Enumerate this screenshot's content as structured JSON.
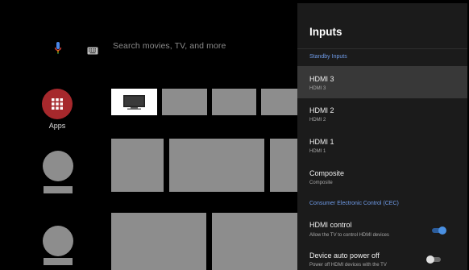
{
  "search": {
    "placeholder": "Search movies, TV, and more"
  },
  "apps": {
    "label": "Apps"
  },
  "panel": {
    "title": "Inputs",
    "standby_section": "Standby Inputs",
    "inputs": [
      {
        "title": "HDMI 3",
        "subtitle": "HDMI 3",
        "selected": true
      },
      {
        "title": "HDMI 2",
        "subtitle": "HDMI 2",
        "selected": false
      },
      {
        "title": "HDMI 1",
        "subtitle": "HDMI 1",
        "selected": false
      },
      {
        "title": "Composite",
        "subtitle": "Composite",
        "selected": false
      }
    ],
    "cec_section": "Consumer Electronic Control (CEC)",
    "cec": [
      {
        "title": "HDMI control",
        "subtitle": "Allow the TV to control HDMI devices",
        "enabled": true
      },
      {
        "title": "Device auto power off",
        "subtitle": "Power off HDMI devices with the TV",
        "enabled": false
      }
    ]
  },
  "colors": {
    "accent_blue": "#6f9be8",
    "toggle_on": "#4a90e2",
    "apps_red": "#a6282c",
    "placeholder_gray": "#8d8d8d"
  },
  "icons": {
    "voice": "mic-icon",
    "keyboard": "keyboard-icon",
    "apps": "apps-grid-icon",
    "tv": "tv-icon"
  }
}
